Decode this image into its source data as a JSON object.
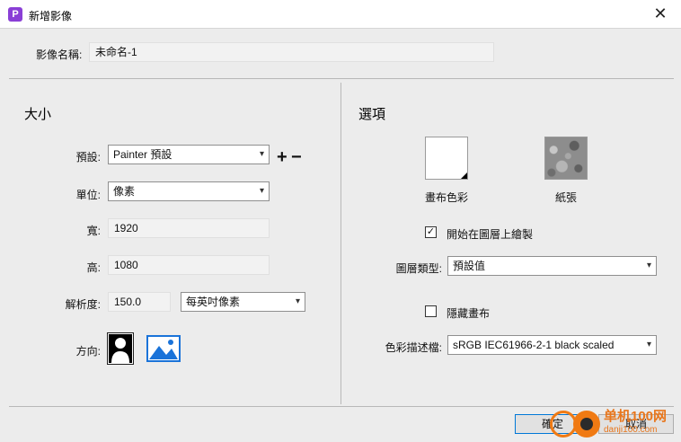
{
  "window": {
    "title": "新增影像",
    "close_glyph": "✕"
  },
  "name_row": {
    "label": "影像名稱:",
    "value": "未命名-1"
  },
  "size_section": {
    "heading": "大小",
    "preset_label": "預設:",
    "preset_value": "Painter 預設",
    "plus_glyph": "+",
    "minus_glyph": "−",
    "unit_label": "單位:",
    "unit_value": "像素",
    "width_label": "寬:",
    "width_value": "1920",
    "height_label": "高:",
    "height_value": "1080",
    "resolution_label": "解析度:",
    "resolution_value": "150.0",
    "resolution_unit": "每英吋像素",
    "orientation_label": "方向:"
  },
  "options_section": {
    "heading": "選項",
    "canvas_color_label": "畫布色彩",
    "paper_label": "紙張",
    "start_on_layer_label": "開始在圖層上繪製",
    "start_on_layer_checked": true,
    "layer_type_label": "圖層類型:",
    "layer_type_value": "預設值",
    "hide_canvas_label": "隱藏畫布",
    "hide_canvas_checked": false,
    "color_profile_label": "色彩描述檔:",
    "color_profile_value": "sRGB IEC61966-2-1 black scaled"
  },
  "buttons": {
    "ok": "確定",
    "cancel": "取消"
  },
  "watermark": {
    "line1": "单机100网",
    "line2": "danji100.com"
  },
  "icons": {
    "app": "painter-app-icon",
    "chevron": "▾",
    "check": "✓"
  },
  "colors": {
    "accent": "#0078d7",
    "dialog_bg": "#ececec",
    "app_icon": "#8a3fd6",
    "orientation_landscape": "#1a73d9",
    "watermark": "#f07a13"
  }
}
